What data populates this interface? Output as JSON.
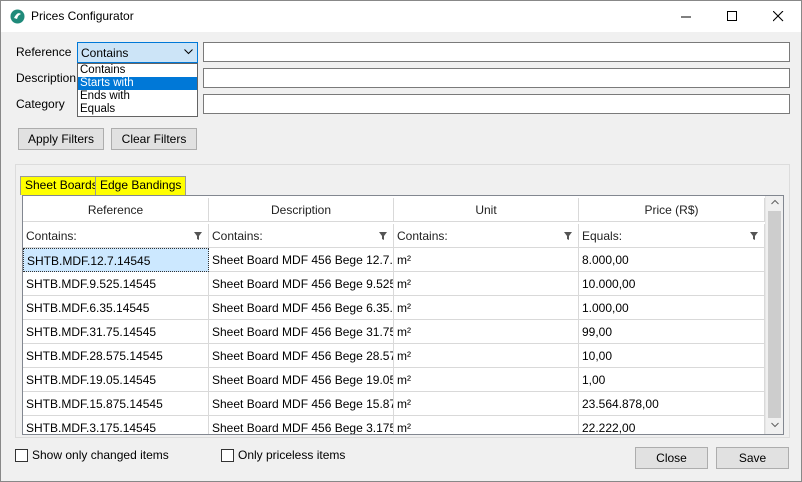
{
  "window": {
    "title": "Prices Configurator",
    "minimize": "—",
    "maximize": "☐",
    "close": "✕"
  },
  "filters": {
    "reference_label": "Reference",
    "description_label": "Description",
    "category_label": "Category",
    "reference_mode": "Contains",
    "reference_value": "",
    "description_value": "",
    "category_value": "",
    "mode_options": [
      "Contains",
      "Starts with",
      "Ends with",
      "Equals"
    ],
    "highlighted_option": "Starts with"
  },
  "buttons": {
    "apply_filters": "Apply Filters",
    "clear_filters": "Clear Filters",
    "close": "Close",
    "save": "Save"
  },
  "tabs": [
    {
      "label": "Sheet Boards",
      "active": true
    },
    {
      "label": "Edge Bandings",
      "active": false
    }
  ],
  "grid": {
    "columns": [
      "Reference",
      "Description",
      "Unit",
      "Price (R$)"
    ],
    "column_filters": [
      "Contains:",
      "Contains:",
      "Contains:",
      "Equals:"
    ],
    "rows": [
      [
        "SHTB.MDF.12.7.14545",
        "Sheet Board MDF 456 Bege 12.7...",
        "m²",
        "8.000,00"
      ],
      [
        "SHTB.MDF.9.525.14545",
        "Sheet Board MDF 456 Bege 9.525...",
        "m²",
        "10.000,00"
      ],
      [
        "SHTB.MDF.6.35.14545",
        "Sheet Board MDF 456 Bege 6.35...",
        "m²",
        "1.000,00"
      ],
      [
        "SHTB.MDF.31.75.14545",
        "Sheet Board MDF 456 Bege 31.75...",
        "m²",
        "99,00"
      ],
      [
        "SHTB.MDF.28.575.14545",
        "Sheet Board MDF 456 Bege 28.57...",
        "m²",
        "10,00"
      ],
      [
        "SHTB.MDF.19.05.14545",
        "Sheet Board MDF 456 Bege 19.05...",
        "m²",
        "1,00"
      ],
      [
        "SHTB.MDF.15.875.14545",
        "Sheet Board MDF 456 Bege 15.87...",
        "m²",
        "23.564.878,00"
      ],
      [
        "SHTB.MDF.3.175.14545",
        "Sheet Board MDF 456 Bege 3.175...",
        "m²",
        "22.222,00"
      ]
    ]
  },
  "options": {
    "show_only_changed": "Show only changed items",
    "only_priceless": "Only priceless items"
  },
  "colors": {
    "tab_highlight": "#ffff00",
    "selection": "#0078d7",
    "combo_bg": "#cce4f7"
  }
}
